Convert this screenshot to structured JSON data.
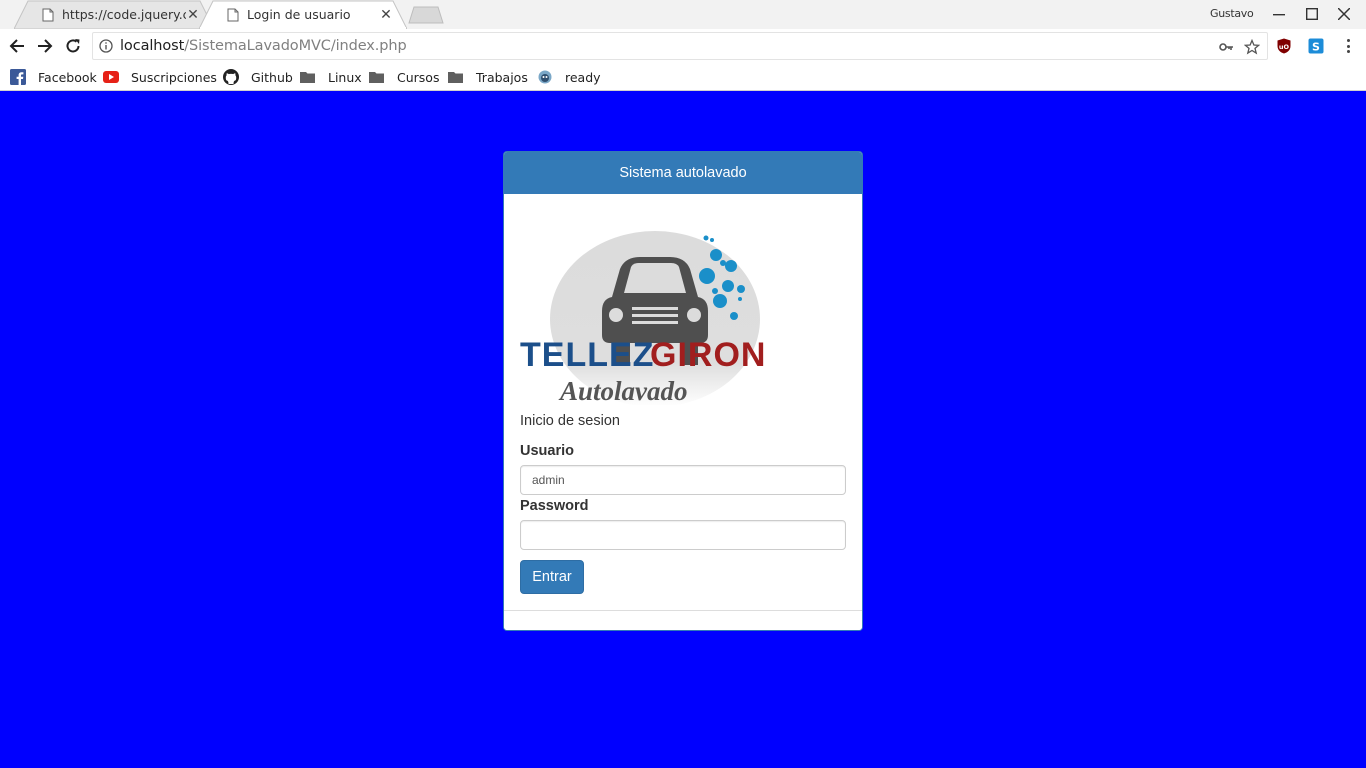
{
  "browser": {
    "tabs": [
      {
        "title": "https://code.jquery.com/"
      },
      {
        "title": "Login de usuario"
      }
    ],
    "profile_name": "Gustavo",
    "url": {
      "host": "localhost",
      "path": "/SistemaLavadoMVC/index.php"
    },
    "bookmarks": [
      {
        "label": "Facebook",
        "icon": "facebook-icon"
      },
      {
        "label": "Suscripciones",
        "icon": "youtube-icon"
      },
      {
        "label": "Github",
        "icon": "github-icon"
      },
      {
        "label": "Linux",
        "icon": "folder-icon"
      },
      {
        "label": "Cursos",
        "icon": "folder-icon"
      },
      {
        "label": "Trabajos",
        "icon": "folder-icon"
      },
      {
        "label": "ready",
        "icon": "ready-icon"
      }
    ]
  },
  "page": {
    "background": "#0000ff",
    "panel_title": "Sistema autolavado",
    "logo": {
      "brand_left": "TELLEZ",
      "brand_right": "GIRON",
      "tagline": "Autolavado"
    },
    "subtitle": "Inicio de sesion",
    "user_label": "Usuario",
    "user_value": "admin",
    "password_label": "Password",
    "password_value": "",
    "submit_label": "Entrar",
    "accent": "#337ab7"
  }
}
